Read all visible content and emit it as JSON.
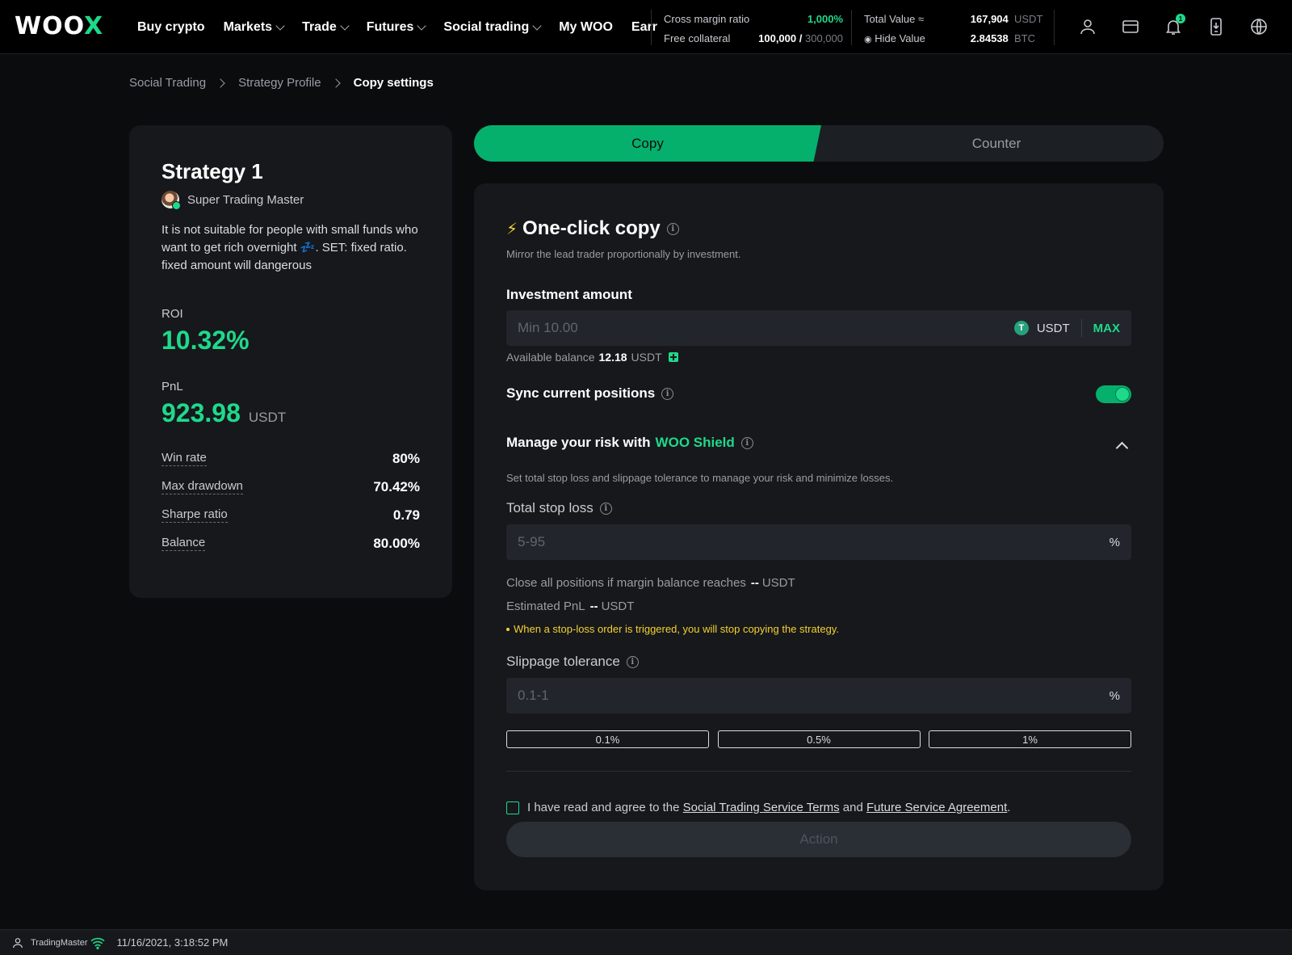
{
  "nav": {
    "logo": "WOOX",
    "items": [
      {
        "label": "Buy crypto",
        "dropdown": false
      },
      {
        "label": "Markets",
        "dropdown": true
      },
      {
        "label": "Trade",
        "dropdown": true
      },
      {
        "label": "Futures",
        "dropdown": true
      },
      {
        "label": "Social trading",
        "dropdown": true
      },
      {
        "label": "My WOO",
        "dropdown": false
      },
      {
        "label": "Earr",
        "dropdown": false
      }
    ],
    "cross_margin_label": "Cross margin ratio",
    "cross_margin_value": "1,000%",
    "free_collateral_label": "Free collateral",
    "free_collateral_value": "100,000",
    "free_collateral_sep": "/",
    "free_collateral_total": "300,000",
    "total_value_label": "Total Value ≈",
    "total_value_usdt": "167,904",
    "total_value_usdt_unit": "USDT",
    "hide_value_label": "Hide Value",
    "total_value_btc": "2.84538",
    "total_value_btc_unit": "BTC",
    "notification_count": "1",
    "icons": [
      "user-icon",
      "wallet-icon",
      "bell-icon",
      "download-app-icon",
      "globe-icon"
    ]
  },
  "breadcrumb": [
    "Social Trading",
    "Strategy Profile",
    "Copy settings"
  ],
  "strategy": {
    "title": "Strategy 1",
    "trader": "Super Trading Master",
    "description_part1": "It is not suitable for people with small funds who want to get rich overnight",
    "description_emoji": "💤",
    "description_part2": ". SET: fixed ratio. fixed amount will dangerous",
    "roi_label": "ROI",
    "roi_value": "10.32%",
    "pnl_label": "PnL",
    "pnl_value": "923.98",
    "pnl_unit": "USDT",
    "metrics": [
      {
        "label": "Win rate",
        "value": "80%"
      },
      {
        "label": "Max drawdown",
        "value": "70.42%"
      },
      {
        "label": "Sharpe ratio",
        "value": "0.79"
      },
      {
        "label": "Balance",
        "value": "80.00%"
      }
    ]
  },
  "tabs": {
    "copy": "Copy",
    "counter": "Counter",
    "active": "copy"
  },
  "one_click": {
    "title": "One-click copy",
    "subtitle": "Mirror the lead trader proportionally by investment.",
    "investment_label": "Investment amount",
    "investment_placeholder": "Min 10.00",
    "investment_value": "",
    "currency": "USDT",
    "currency_icon_letter": "T",
    "max_label": "MAX",
    "available_label": "Available balance",
    "available_value": "12.18",
    "available_unit": "USDT",
    "sync_label": "Sync current positions",
    "sync_enabled": true,
    "risk_label_prefix": "Manage your risk with",
    "risk_label_brand": "WOO Shield",
    "risk_subtitle": "Set total stop loss and slippage tolerance to manage your risk and minimize losses.",
    "stop_loss_label": "Total stop loss",
    "stop_loss_placeholder": "5-95",
    "stop_loss_value": "",
    "percent_unit": "%",
    "close_all_label": "Close all positions if margin balance reaches",
    "close_all_value": "--",
    "close_all_unit": "USDT",
    "estimated_pnl_label": "Estimated PnL",
    "estimated_pnl_value": "--",
    "estimated_pnl_unit": "USDT",
    "warning": "When a stop-loss order is triggered, you will stop copying the strategy.",
    "slippage_label": "Slippage tolerance",
    "slippage_placeholder": "0.1-1",
    "slippage_value": "",
    "slippage_presets": [
      "0.1%",
      "0.5%",
      "1%"
    ],
    "agree_prefix": "I have read and agree to the",
    "terms_link": "Social Trading Service Terms",
    "agree_and": "and",
    "agreement_link": "Future Service Agreement",
    "agree_suffix": ".",
    "agreed": false,
    "action_label": "Action"
  },
  "status_bar": {
    "user": "TradingMaster",
    "datetime": "11/16/2021, 3:18:52 PM"
  },
  "colors": {
    "accent_green": "#1fd98b",
    "tab_green": "#05b06d",
    "warning_yellow": "#f6d02f",
    "background": "#0b0c0e",
    "card": "#16181c"
  }
}
